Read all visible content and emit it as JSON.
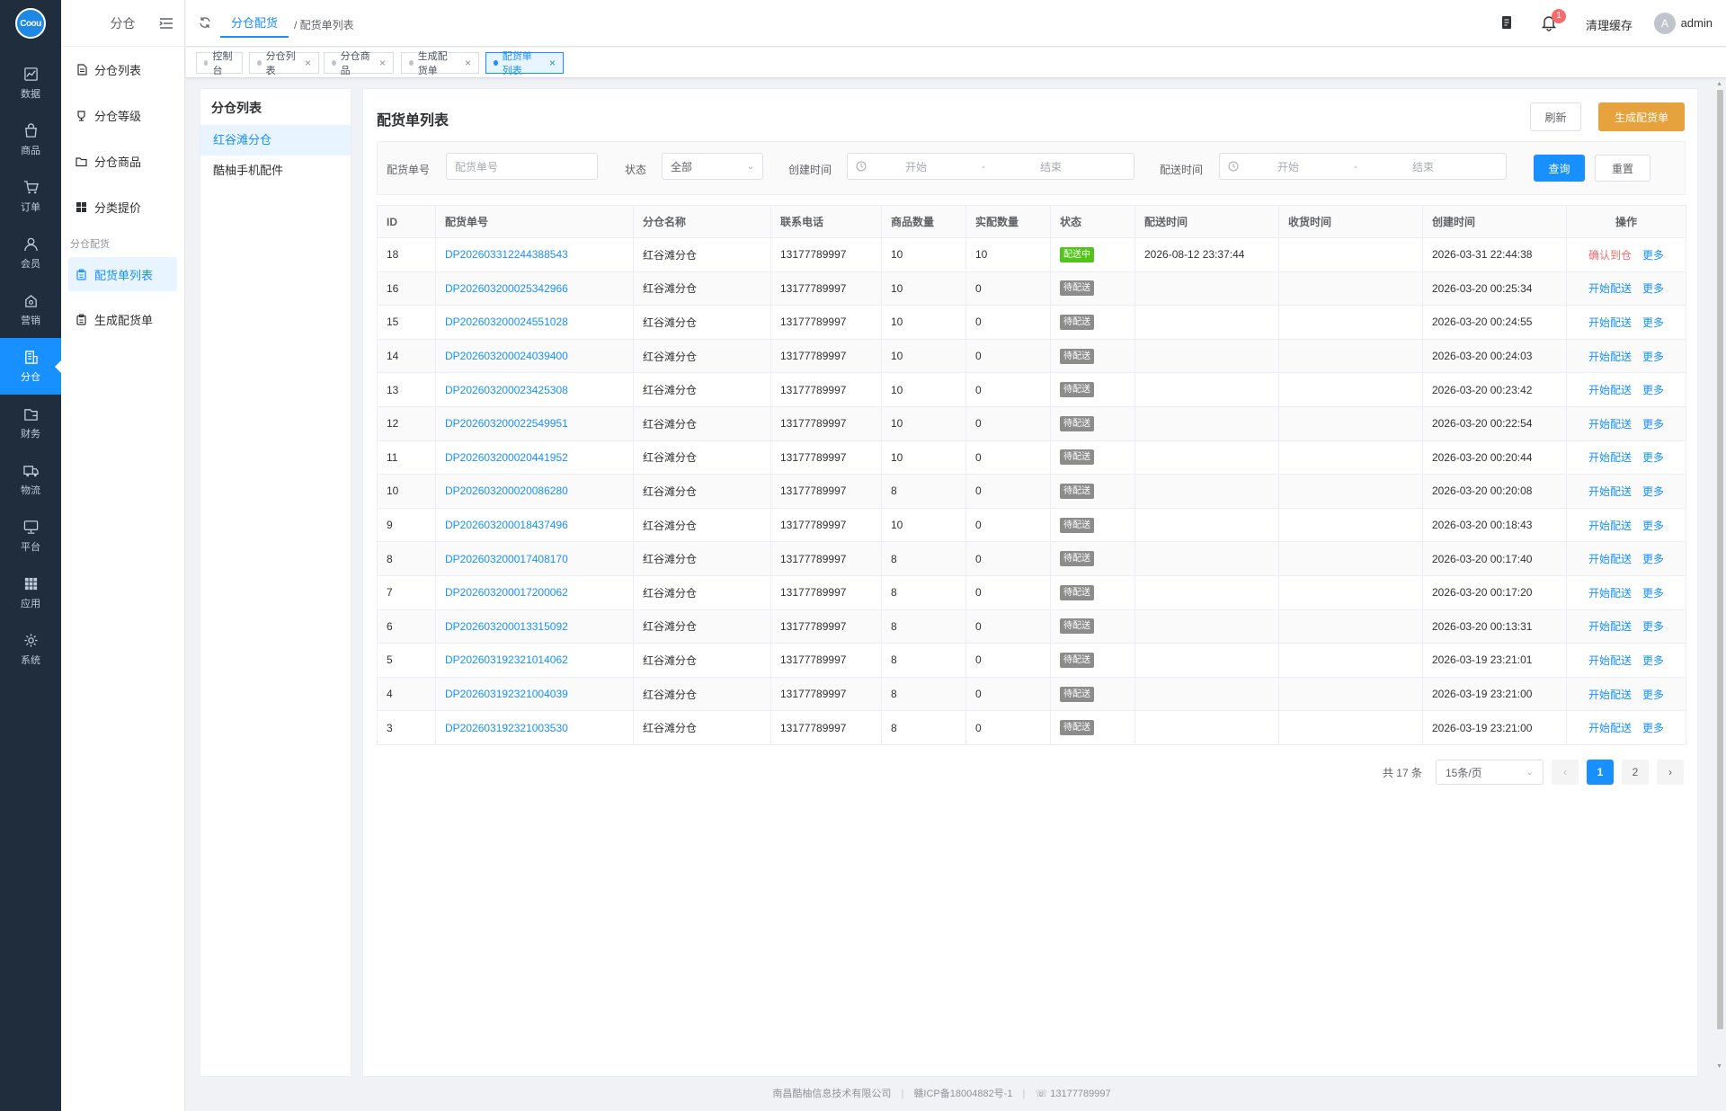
{
  "rail": {
    "logo": "Coou",
    "items": [
      {
        "label": "数据",
        "icon": "chart-icon"
      },
      {
        "label": "商品",
        "icon": "bag-icon"
      },
      {
        "label": "订单",
        "icon": "cart-icon"
      },
      {
        "label": "会员",
        "icon": "user-icon"
      },
      {
        "label": "营销",
        "icon": "marketing-icon"
      },
      {
        "label": "分仓",
        "icon": "building-icon",
        "active": true
      },
      {
        "label": "财务",
        "icon": "wallet-icon"
      },
      {
        "label": "物流",
        "icon": "truck-icon"
      },
      {
        "label": "平台",
        "icon": "monitor-icon"
      },
      {
        "label": "应用",
        "icon": "apps-icon"
      },
      {
        "label": "系统",
        "icon": "gear-icon"
      }
    ]
  },
  "submenu": {
    "title": "分仓",
    "items": [
      {
        "label": "分仓列表",
        "icon": "document-icon"
      },
      {
        "label": "分仓等级",
        "icon": "cup-icon"
      },
      {
        "label": "分仓商品",
        "icon": "folder-icon"
      },
      {
        "label": "分类提价",
        "icon": "grid-icon"
      }
    ],
    "group_label": "分仓配货",
    "group_items": [
      {
        "label": "配货单列表",
        "icon": "clipboard-icon",
        "active": true
      },
      {
        "label": "生成配货单",
        "icon": "clipboard-icon"
      }
    ]
  },
  "topbar": {
    "breadcrumb_active": "分仓配货",
    "breadcrumb_current": "/ 配货单列表",
    "notification_count": "1",
    "clear_cache": "清理缓存",
    "avatar_letter": "A",
    "username": "admin"
  },
  "tags": [
    {
      "label": "控制台",
      "closable": false,
      "active": false
    },
    {
      "label": "分仓列表",
      "closable": true,
      "active": false
    },
    {
      "label": "分仓商品",
      "closable": true,
      "active": false
    },
    {
      "label": "生成配货单",
      "closable": true,
      "active": false
    },
    {
      "label": "配货单列表",
      "closable": true,
      "active": true
    }
  ],
  "warehouse_panel": {
    "title": "分仓列表",
    "items": [
      "红谷滩分仓",
      "酷柚手机配件"
    ]
  },
  "card": {
    "title": "配货单列表",
    "refresh_label": "刷新",
    "generate_label": "生成配货单"
  },
  "filters": {
    "order_no_label": "配货单号",
    "order_no_placeholder": "配货单号",
    "status_label": "状态",
    "status_value": "全部",
    "created_label": "创建时间",
    "delivery_label": "配送时间",
    "range_start": "开始",
    "range_sep": "-",
    "range_end": "结束",
    "query_label": "查询",
    "reset_label": "重置"
  },
  "table": {
    "headers": [
      "ID",
      "配货单号",
      "分仓名称",
      "联系电话",
      "商品数量",
      "实配数量",
      "状态",
      "配送时间",
      "收货时间",
      "创建时间",
      "操作"
    ],
    "more_label": "更多",
    "rows": [
      {
        "id": "18",
        "code": "DP202603312244388543",
        "warehouse": "红谷滩分仓",
        "phone": "13177789997",
        "qty": "10",
        "actual": "10",
        "status": "配送中",
        "status_color": "#52c41a",
        "delivery_time": "2026-08-12 23:37:44",
        "receive_time": "",
        "created": "2026-03-31 22:44:38",
        "action": "确认到仓",
        "action_color": "#f56c6c"
      },
      {
        "id": "16",
        "code": "DP202603200025342966",
        "warehouse": "红谷滩分仓",
        "phone": "13177789997",
        "qty": "10",
        "actual": "0",
        "status": "待配送",
        "status_color": "#8c8c8c",
        "delivery_time": "",
        "receive_time": "",
        "created": "2026-03-20 00:25:34",
        "action": "开始配送",
        "action_color": "#1890ff"
      },
      {
        "id": "15",
        "code": "DP202603200024551028",
        "warehouse": "红谷滩分仓",
        "phone": "13177789997",
        "qty": "10",
        "actual": "0",
        "status": "待配送",
        "status_color": "#8c8c8c",
        "delivery_time": "",
        "receive_time": "",
        "created": "2026-03-20 00:24:55",
        "action": "开始配送",
        "action_color": "#1890ff"
      },
      {
        "id": "14",
        "code": "DP202603200024039400",
        "warehouse": "红谷滩分仓",
        "phone": "13177789997",
        "qty": "10",
        "actual": "0",
        "status": "待配送",
        "status_color": "#8c8c8c",
        "delivery_time": "",
        "receive_time": "",
        "created": "2026-03-20 00:24:03",
        "action": "开始配送",
        "action_color": "#1890ff"
      },
      {
        "id": "13",
        "code": "DP202603200023425308",
        "warehouse": "红谷滩分仓",
        "phone": "13177789997",
        "qty": "10",
        "actual": "0",
        "status": "待配送",
        "status_color": "#8c8c8c",
        "delivery_time": "",
        "receive_time": "",
        "created": "2026-03-20 00:23:42",
        "action": "开始配送",
        "action_color": "#1890ff"
      },
      {
        "id": "12",
        "code": "DP202603200022549951",
        "warehouse": "红谷滩分仓",
        "phone": "13177789997",
        "qty": "10",
        "actual": "0",
        "status": "待配送",
        "status_color": "#8c8c8c",
        "delivery_time": "",
        "receive_time": "",
        "created": "2026-03-20 00:22:54",
        "action": "开始配送",
        "action_color": "#1890ff"
      },
      {
        "id": "11",
        "code": "DP202603200020441952",
        "warehouse": "红谷滩分仓",
        "phone": "13177789997",
        "qty": "10",
        "actual": "0",
        "status": "待配送",
        "status_color": "#8c8c8c",
        "delivery_time": "",
        "receive_time": "",
        "created": "2026-03-20 00:20:44",
        "action": "开始配送",
        "action_color": "#1890ff"
      },
      {
        "id": "10",
        "code": "DP202603200020086280",
        "warehouse": "红谷滩分仓",
        "phone": "13177789997",
        "qty": "8",
        "actual": "0",
        "status": "待配送",
        "status_color": "#8c8c8c",
        "delivery_time": "",
        "receive_time": "",
        "created": "2026-03-20 00:20:08",
        "action": "开始配送",
        "action_color": "#1890ff"
      },
      {
        "id": "9",
        "code": "DP202603200018437496",
        "warehouse": "红谷滩分仓",
        "phone": "13177789997",
        "qty": "10",
        "actual": "0",
        "status": "待配送",
        "status_color": "#8c8c8c",
        "delivery_time": "",
        "receive_time": "",
        "created": "2026-03-20 00:18:43",
        "action": "开始配送",
        "action_color": "#1890ff"
      },
      {
        "id": "8",
        "code": "DP202603200017408170",
        "warehouse": "红谷滩分仓",
        "phone": "13177789997",
        "qty": "8",
        "actual": "0",
        "status": "待配送",
        "status_color": "#8c8c8c",
        "delivery_time": "",
        "receive_time": "",
        "created": "2026-03-20 00:17:40",
        "action": "开始配送",
        "action_color": "#1890ff"
      },
      {
        "id": "7",
        "code": "DP202603200017200062",
        "warehouse": "红谷滩分仓",
        "phone": "13177789997",
        "qty": "8",
        "actual": "0",
        "status": "待配送",
        "status_color": "#8c8c8c",
        "delivery_time": "",
        "receive_time": "",
        "created": "2026-03-20 00:17:20",
        "action": "开始配送",
        "action_color": "#1890ff"
      },
      {
        "id": "6",
        "code": "DP202603200013315092",
        "warehouse": "红谷滩分仓",
        "phone": "13177789997",
        "qty": "8",
        "actual": "0",
        "status": "待配送",
        "status_color": "#8c8c8c",
        "delivery_time": "",
        "receive_time": "",
        "created": "2026-03-20 00:13:31",
        "action": "开始配送",
        "action_color": "#1890ff"
      },
      {
        "id": "5",
        "code": "DP202603192321014062",
        "warehouse": "红谷滩分仓",
        "phone": "13177789997",
        "qty": "8",
        "actual": "0",
        "status": "待配送",
        "status_color": "#8c8c8c",
        "delivery_time": "",
        "receive_time": "",
        "created": "2026-03-19 23:21:01",
        "action": "开始配送",
        "action_color": "#1890ff"
      },
      {
        "id": "4",
        "code": "DP202603192321004039",
        "warehouse": "红谷滩分仓",
        "phone": "13177789997",
        "qty": "8",
        "actual": "0",
        "status": "待配送",
        "status_color": "#8c8c8c",
        "delivery_time": "",
        "receive_time": "",
        "created": "2026-03-19 23:21:00",
        "action": "开始配送",
        "action_color": "#1890ff"
      },
      {
        "id": "3",
        "code": "DP202603192321003530",
        "warehouse": "红谷滩分仓",
        "phone": "13177789997",
        "qty": "8",
        "actual": "0",
        "status": "待配送",
        "status_color": "#8c8c8c",
        "delivery_time": "",
        "receive_time": "",
        "created": "2026-03-19 23:21:00",
        "action": "开始配送",
        "action_color": "#1890ff"
      }
    ]
  },
  "pagination": {
    "total": "共 17 条",
    "page_size": "15条/页",
    "prev": "‹",
    "pages": [
      "1",
      "2"
    ],
    "current": "1",
    "next": "›"
  },
  "footer": {
    "company": "南昌酷柚信息技术有限公司",
    "icp": "赣ICP备18004882号-1",
    "phone": "13177789997"
  }
}
